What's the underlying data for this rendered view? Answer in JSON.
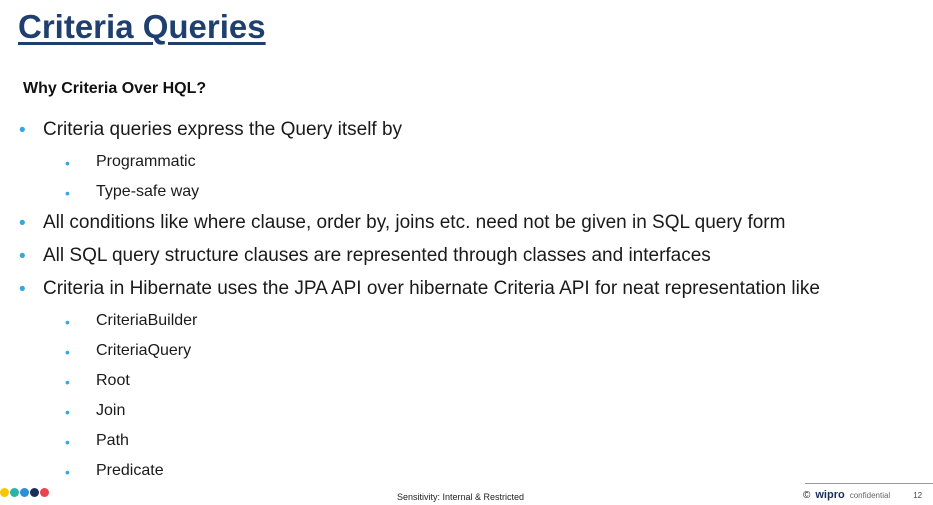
{
  "slide": {
    "title": "Criteria Queries",
    "subtitle": "Why Criteria Over HQL?",
    "bullets": [
      {
        "text": "Criteria queries express the Query itself by",
        "children": [
          "Programmatic",
          "Type-safe way"
        ]
      },
      {
        "text": "All conditions like where clause, order by, joins etc. need not be given in SQL query form"
      },
      {
        "text": "All SQL query structure clauses are represented through classes and interfaces"
      },
      {
        "text": "Criteria in Hibernate uses the JPA API over hibernate Criteria API for neat representation like",
        "children": [
          "CriteriaBuilder",
          "CriteriaQuery",
          "Root",
          "Join",
          "Path",
          "Predicate"
        ]
      }
    ]
  },
  "footer": {
    "sensitivity": "Sensitivity: Internal & Restricted",
    "copyright_symbol": "©",
    "brand": "wipro",
    "confidential": "confidential",
    "page_number": "12",
    "dot_colors": [
      "#f6c700",
      "#2db3a6",
      "#2a8fd6",
      "#1a2e5a",
      "#e8434f"
    ]
  },
  "colors": {
    "title": "#1f3f6e",
    "bullet": "#3aa5dc"
  }
}
